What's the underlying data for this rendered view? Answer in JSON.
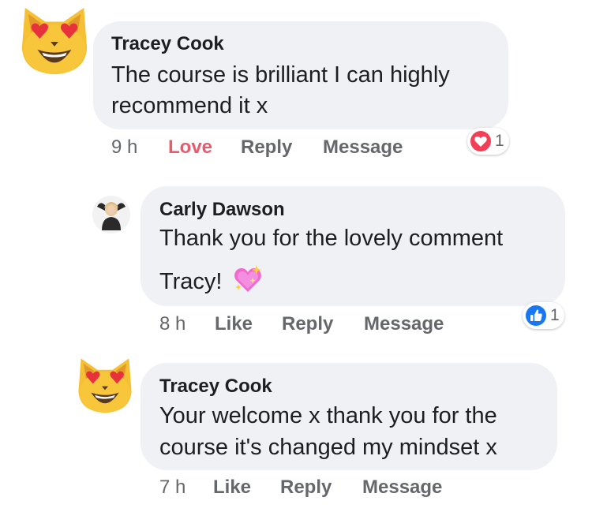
{
  "comments": [
    {
      "author": "Tracey Cook",
      "lines": [
        "The course is brilliant I can highly",
        "recommend it  x"
      ],
      "time": "9 h",
      "action_primary": "Love",
      "reply": "Reply",
      "message": "Message",
      "reaction_count": "1",
      "reaction_type": "heart-icon",
      "avatar": "heart-eyes-cat-icon"
    },
    {
      "author": "Carly Dawson",
      "lines": [
        "Thank you for the lovely comment",
        "Tracy!"
      ],
      "emoji": "sparkling-heart-icon",
      "time": "8 h",
      "action_primary": "Like",
      "reply": "Reply",
      "message": "Message",
      "reaction_count": "1",
      "reaction_type": "thumbs-up-icon",
      "avatar": "user-photo-avatar"
    },
    {
      "author": "Tracey Cook",
      "lines": [
        "Your welcome x thank you for the",
        "course it's changed my mindset x"
      ],
      "time": "7 h",
      "action_primary": "Like",
      "reply": "Reply",
      "message": "Message",
      "avatar": "heart-eyes-cat-icon"
    }
  ],
  "colors": {
    "bubble": "#f0f1f4",
    "love": "#e85a6c",
    "like_blue": "#1877f2",
    "muted": "#65676b"
  }
}
